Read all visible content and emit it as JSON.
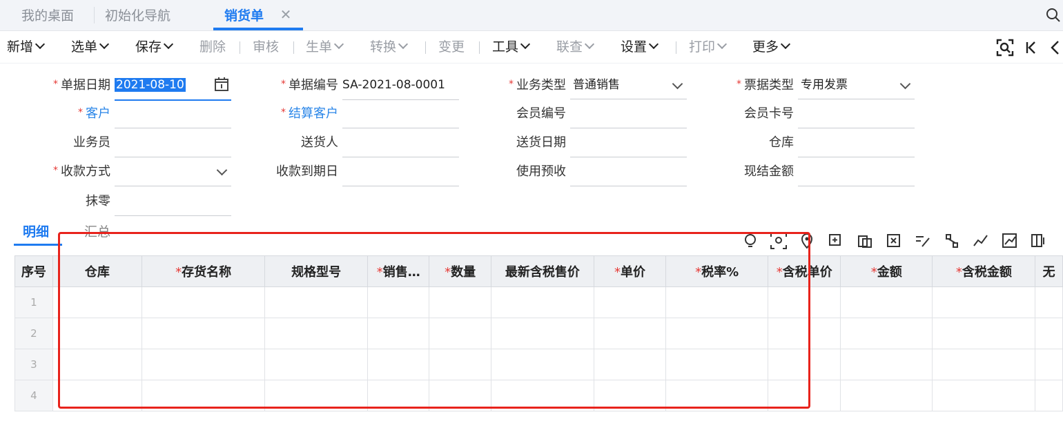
{
  "tabs": [
    {
      "label": "我的桌面",
      "active": false
    },
    {
      "label": "初始化导航",
      "active": false
    },
    {
      "label": "销货单",
      "active": true
    }
  ],
  "toolbar": {
    "new": "新增",
    "select_doc": "选单",
    "save": "保存",
    "delete": "删除",
    "audit": "审核",
    "generate": "生单",
    "convert": "转换",
    "change": "变更",
    "tools": "工具",
    "link_query": "联查",
    "settings": "设置",
    "print": "打印",
    "more": "更多"
  },
  "form": {
    "doc_date": {
      "label": "单据日期",
      "value": "2021-08-10"
    },
    "doc_no": {
      "label": "单据编号",
      "value": "SA-2021-08-0001"
    },
    "biz_type": {
      "label": "业务类型",
      "value": "普通销售"
    },
    "invoice_type": {
      "label": "票据类型",
      "value": "专用发票"
    },
    "customer": {
      "label": "客户",
      "value": ""
    },
    "settle_customer": {
      "label": "结算客户",
      "value": ""
    },
    "member_no": {
      "label": "会员编号",
      "value": ""
    },
    "member_card": {
      "label": "会员卡号",
      "value": ""
    },
    "salesman": {
      "label": "业务员",
      "value": ""
    },
    "deliverer": {
      "label": "送货人",
      "value": ""
    },
    "delivery_date": {
      "label": "送货日期",
      "value": ""
    },
    "warehouse": {
      "label": "仓库",
      "value": ""
    },
    "payment_method": {
      "label": "收款方式",
      "value": ""
    },
    "due_date": {
      "label": "收款到期日",
      "value": ""
    },
    "use_prepaid": {
      "label": "使用预收",
      "value": ""
    },
    "cash_amount": {
      "label": "现结金额",
      "value": ""
    },
    "rounding": {
      "label": "抹零",
      "value": ""
    }
  },
  "detail_tabs": {
    "detail": "明细",
    "summary": "汇总"
  },
  "grid": {
    "columns": [
      "序号",
      "仓库",
      "存货名称",
      "规格型号",
      "销售…",
      "数量",
      "最新含税售价",
      "单价",
      "税率%",
      "含税单价",
      "金额",
      "含税金额",
      "无"
    ],
    "rows": [
      "1",
      "2",
      "3",
      "4"
    ]
  },
  "colors": {
    "accent": "#1f7bf0",
    "required": "#e53935",
    "highlight": "#e8231c"
  }
}
